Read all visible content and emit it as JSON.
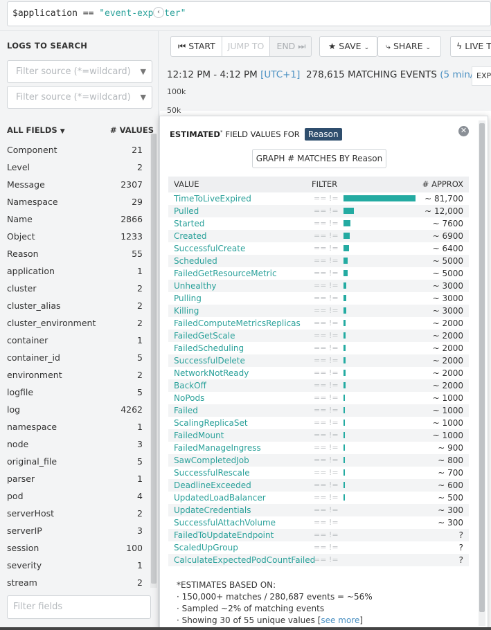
{
  "query": {
    "var": "$application",
    "op": "==",
    "value": "\"event-exporter\""
  },
  "sidebar": {
    "logs_title": "LOGS TO SEARCH",
    "source_placeholder_1": "Filter source (*=wildcard)",
    "source_placeholder_2": "Filter source (*=wildcard)",
    "all_fields_label": "ALL FIELDS",
    "values_label": "# VALUES",
    "filter_fields_placeholder": "Filter fields",
    "fields": [
      {
        "name": "Component",
        "count": "21"
      },
      {
        "name": "Level",
        "count": "2"
      },
      {
        "name": "Message",
        "count": "2307"
      },
      {
        "name": "Namespace",
        "count": "29"
      },
      {
        "name": "Name",
        "count": "2866"
      },
      {
        "name": "Object",
        "count": "1233"
      },
      {
        "name": "Reason",
        "count": "55"
      },
      {
        "name": "application",
        "count": "1"
      },
      {
        "name": "cluster",
        "count": "2"
      },
      {
        "name": "cluster_alias",
        "count": "2"
      },
      {
        "name": "cluster_environment",
        "count": "2"
      },
      {
        "name": "container",
        "count": "1"
      },
      {
        "name": "container_id",
        "count": "5"
      },
      {
        "name": "environment",
        "count": "2"
      },
      {
        "name": "logfile",
        "count": "5"
      },
      {
        "name": "log",
        "count": "4262"
      },
      {
        "name": "namespace",
        "count": "1"
      },
      {
        "name": "node",
        "count": "3"
      },
      {
        "name": "original_file",
        "count": "5"
      },
      {
        "name": "parser",
        "count": "1"
      },
      {
        "name": "pod",
        "count": "4"
      },
      {
        "name": "serverHost",
        "count": "2"
      },
      {
        "name": "serverIP",
        "count": "3"
      },
      {
        "name": "session",
        "count": "100"
      },
      {
        "name": "severity",
        "count": "1"
      },
      {
        "name": "stream",
        "count": "2"
      }
    ]
  },
  "toolbar": {
    "start": "START",
    "jump_to": "JUMP TO",
    "end": "END",
    "save": "SAVE",
    "share": "SHARE",
    "live": "LIVE T"
  },
  "timeline": {
    "range": "12:12 PM - 4:12 PM",
    "tz": "[UTC+1]",
    "matching": "278,615 MATCHING EVENTS",
    "interval": "(5 min/bar)",
    "export_btn": "EXP",
    "y_ticks": [
      "100k",
      "50k"
    ]
  },
  "popover": {
    "title_a": "ESTIMATED",
    "title_b": "FIELD VALUES FOR",
    "field": "Reason",
    "graph_button": "GRAPH  # MATCHES BY Reason",
    "col_value": "VALUE",
    "col_filter": "FILTER",
    "col_approx": "# APPROX",
    "filter_glyph": "==  !=",
    "rows": [
      {
        "name": "TimeToLiveExpired",
        "approx": "~ 81,700",
        "frac": 1.0
      },
      {
        "name": "Pulled",
        "approx": "~ 12,000",
        "frac": 0.147
      },
      {
        "name": "Started",
        "approx": "~ 7600",
        "frac": 0.093
      },
      {
        "name": "Created",
        "approx": "~ 6900",
        "frac": 0.084
      },
      {
        "name": "SuccessfulCreate",
        "approx": "~ 6400",
        "frac": 0.078
      },
      {
        "name": "Scheduled",
        "approx": "~ 5000",
        "frac": 0.061
      },
      {
        "name": "FailedGetResourceMetric",
        "approx": "~ 5000",
        "frac": 0.061
      },
      {
        "name": "Unhealthy",
        "approx": "~ 3000",
        "frac": 0.037
      },
      {
        "name": "Pulling",
        "approx": "~ 3000",
        "frac": 0.037
      },
      {
        "name": "Killing",
        "approx": "~ 3000",
        "frac": 0.037
      },
      {
        "name": "FailedComputeMetricsReplicas",
        "approx": "~ 2000",
        "frac": 0.029
      },
      {
        "name": "FailedGetScale",
        "approx": "~ 2000",
        "frac": 0.029
      },
      {
        "name": "FailedScheduling",
        "approx": "~ 2000",
        "frac": 0.029
      },
      {
        "name": "SuccessfulDelete",
        "approx": "~ 2000",
        "frac": 0.029
      },
      {
        "name": "NetworkNotReady",
        "approx": "~ 2000",
        "frac": 0.029
      },
      {
        "name": "BackOff",
        "approx": "~ 2000",
        "frac": 0.029
      },
      {
        "name": "NoPods",
        "approx": "~ 1000",
        "frac": 0.02
      },
      {
        "name": "Failed",
        "approx": "~ 1000",
        "frac": 0.02
      },
      {
        "name": "ScalingReplicaSet",
        "approx": "~ 1000",
        "frac": 0.02
      },
      {
        "name": "FailedMount",
        "approx": "~ 1000",
        "frac": 0.012
      },
      {
        "name": "FailedManageIngress",
        "approx": "~ 900",
        "frac": 0.011
      },
      {
        "name": "SawCompletedJob",
        "approx": "~ 800",
        "frac": 0.01
      },
      {
        "name": "SuccessfulRescale",
        "approx": "~ 700",
        "frac": 0.009
      },
      {
        "name": "DeadlineExceeded",
        "approx": "~ 600",
        "frac": 0.008
      },
      {
        "name": "UpdatedLoadBalancer",
        "approx": "~ 500",
        "frac": 0.007
      },
      {
        "name": "UpdateCredentials",
        "approx": "~ 300",
        "frac": 0
      },
      {
        "name": "SuccessfulAttachVolume",
        "approx": "~ 300",
        "frac": 0
      },
      {
        "name": "FailedToUpdateEndpoint",
        "approx": "?",
        "frac": 0
      },
      {
        "name": "ScaledUpGroup",
        "approx": "?",
        "frac": 0
      },
      {
        "name": "CalculateExpectedPodCountFailed",
        "approx": "?",
        "frac": 0
      }
    ],
    "footnote": {
      "heading": "*ESTIMATES BASED ON:",
      "line1": "· 150,000+ matches / 280,687 events = ~56%",
      "line2": "· Sampled ~2% of matching events",
      "line3_a": "· Showing 30 of 55 unique values [",
      "line3_link": "see more",
      "line3_b": "]"
    }
  },
  "colors": {
    "accent": "#2aa19a",
    "bar": "#24aba2",
    "badge": "#2f4e6d",
    "link": "#4a90c2"
  }
}
